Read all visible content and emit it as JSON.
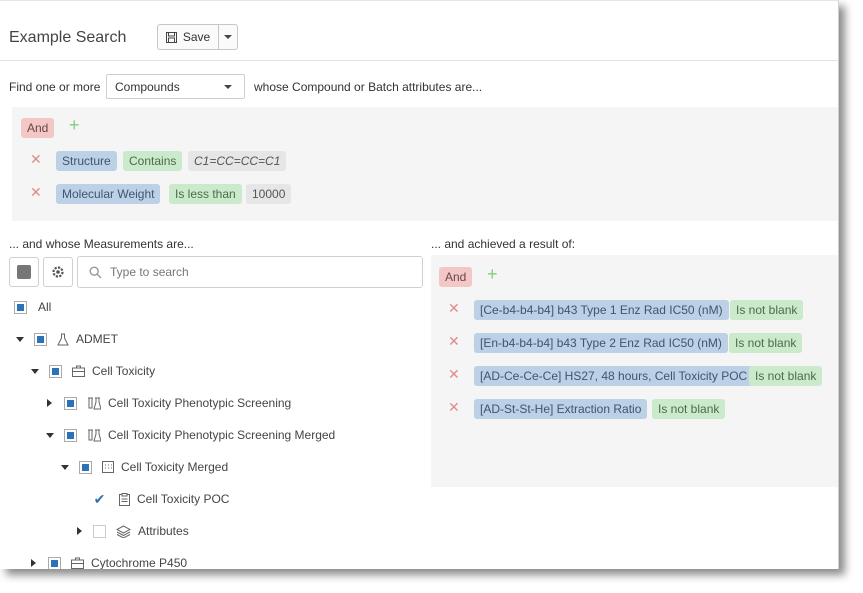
{
  "header": {
    "title": "Example Search",
    "save_label": "Save"
  },
  "find": {
    "prefix": "Find one or more",
    "entity": "Compounds",
    "suffix": "whose Compound or Batch attributes are..."
  },
  "compound_query": {
    "operator": "And",
    "conditions": [
      {
        "field": "Structure",
        "op": "Contains",
        "value": "C1=CC=CC=C1"
      },
      {
        "field": "Molecular Weight",
        "op": "Is less than",
        "value": "10000"
      }
    ]
  },
  "measurements": {
    "heading": "... and whose Measurements are...",
    "search_placeholder": "Type to search",
    "all_label": "All",
    "tree": [
      {
        "label": "ADMET",
        "icon": "flask-icon"
      },
      {
        "label": "Cell Toxicity",
        "icon": "briefcase-icon"
      },
      {
        "label": "Cell Toxicity Phenotypic Screening",
        "icon": "lab-icon"
      },
      {
        "label": "Cell Toxicity Phenotypic Screening Merged",
        "icon": "lab-icon"
      },
      {
        "label": "Cell Toxicity Merged",
        "icon": "grid-icon"
      },
      {
        "label": "Cell Toxicity POC",
        "icon": "clipboard-icon"
      },
      {
        "label": "Attributes",
        "icon": "layers-icon"
      },
      {
        "label": "Cytochrome P450",
        "icon": "briefcase-icon"
      }
    ]
  },
  "results": {
    "heading": "... and achieved a result of:",
    "operator": "And",
    "conditions": [
      {
        "field": "[Ce-b4-b4-b4] b43 Type 1 Enz Rad IC50 (nM)",
        "op": "Is not blank"
      },
      {
        "field": "[En-b4-b4-b4] b43 Type 2 Enz Rad IC50 (nM)",
        "op": "Is not blank"
      },
      {
        "field": "[AD-Ce-Ce-Ce] HS27, 48 hours, Cell Toxicity POC",
        "op": "Is not blank"
      },
      {
        "field": "[AD-St-St-He] Extraction Ratio",
        "op": "Is not blank"
      }
    ]
  },
  "colors": {
    "and_chip": "#f4c7c7",
    "field_chip": "#bcd0e6",
    "op_chip": "#cbe9cb",
    "checkbox": "#2d72b8"
  }
}
